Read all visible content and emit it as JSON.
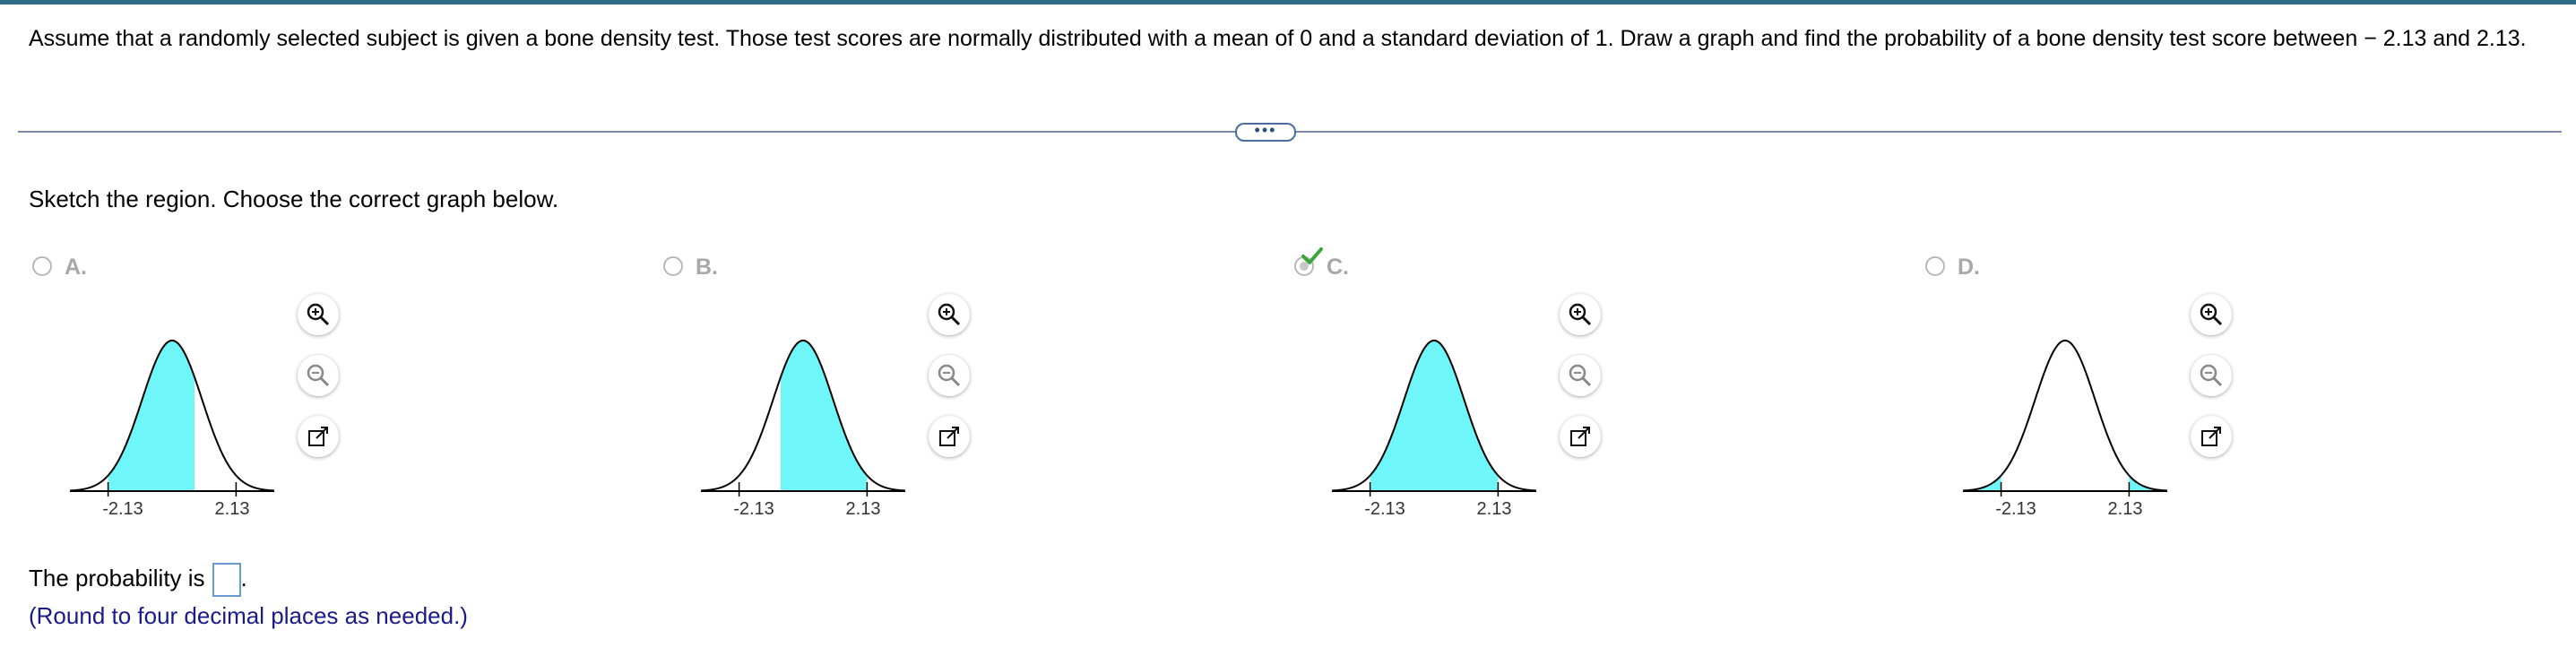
{
  "question": {
    "text": "Assume that a randomly selected subject is given a bone density test. Those test scores are normally distributed with a mean of 0 and a standard deviation of 1. Draw a graph and find the probability of a bone density test score between − 2.13 and 2.13."
  },
  "more_button": {
    "label": "•••"
  },
  "prompt": {
    "text": "Sketch the region. Choose the correct graph below."
  },
  "options": [
    {
      "label": "A.",
      "selected": false,
      "shading": "left",
      "ticks": [
        "-2.13",
        "2.13"
      ]
    },
    {
      "label": "B.",
      "selected": false,
      "shading": "right",
      "ticks": [
        "-2.13",
        "2.13"
      ]
    },
    {
      "label": "C.",
      "selected": true,
      "shading": "between",
      "ticks": [
        "-2.13",
        "2.13"
      ]
    },
    {
      "label": "D.",
      "selected": false,
      "shading": "tails",
      "ticks": [
        "-2.13",
        "2.13"
      ]
    }
  ],
  "tools": {
    "zoom_in_icon": "zoom-in-icon",
    "zoom_out_icon": "zoom-out-icon",
    "popout_icon": "external-link-icon"
  },
  "answer": {
    "prefix": "The probability is",
    "suffix": ".",
    "value": ""
  },
  "hint": {
    "text": "(Round to four decimal places as needed.)"
  },
  "colors": {
    "shade": "#6ff6f9",
    "curve": "#000000",
    "check": "#3aa53a",
    "accent": "#2d6b86"
  }
}
